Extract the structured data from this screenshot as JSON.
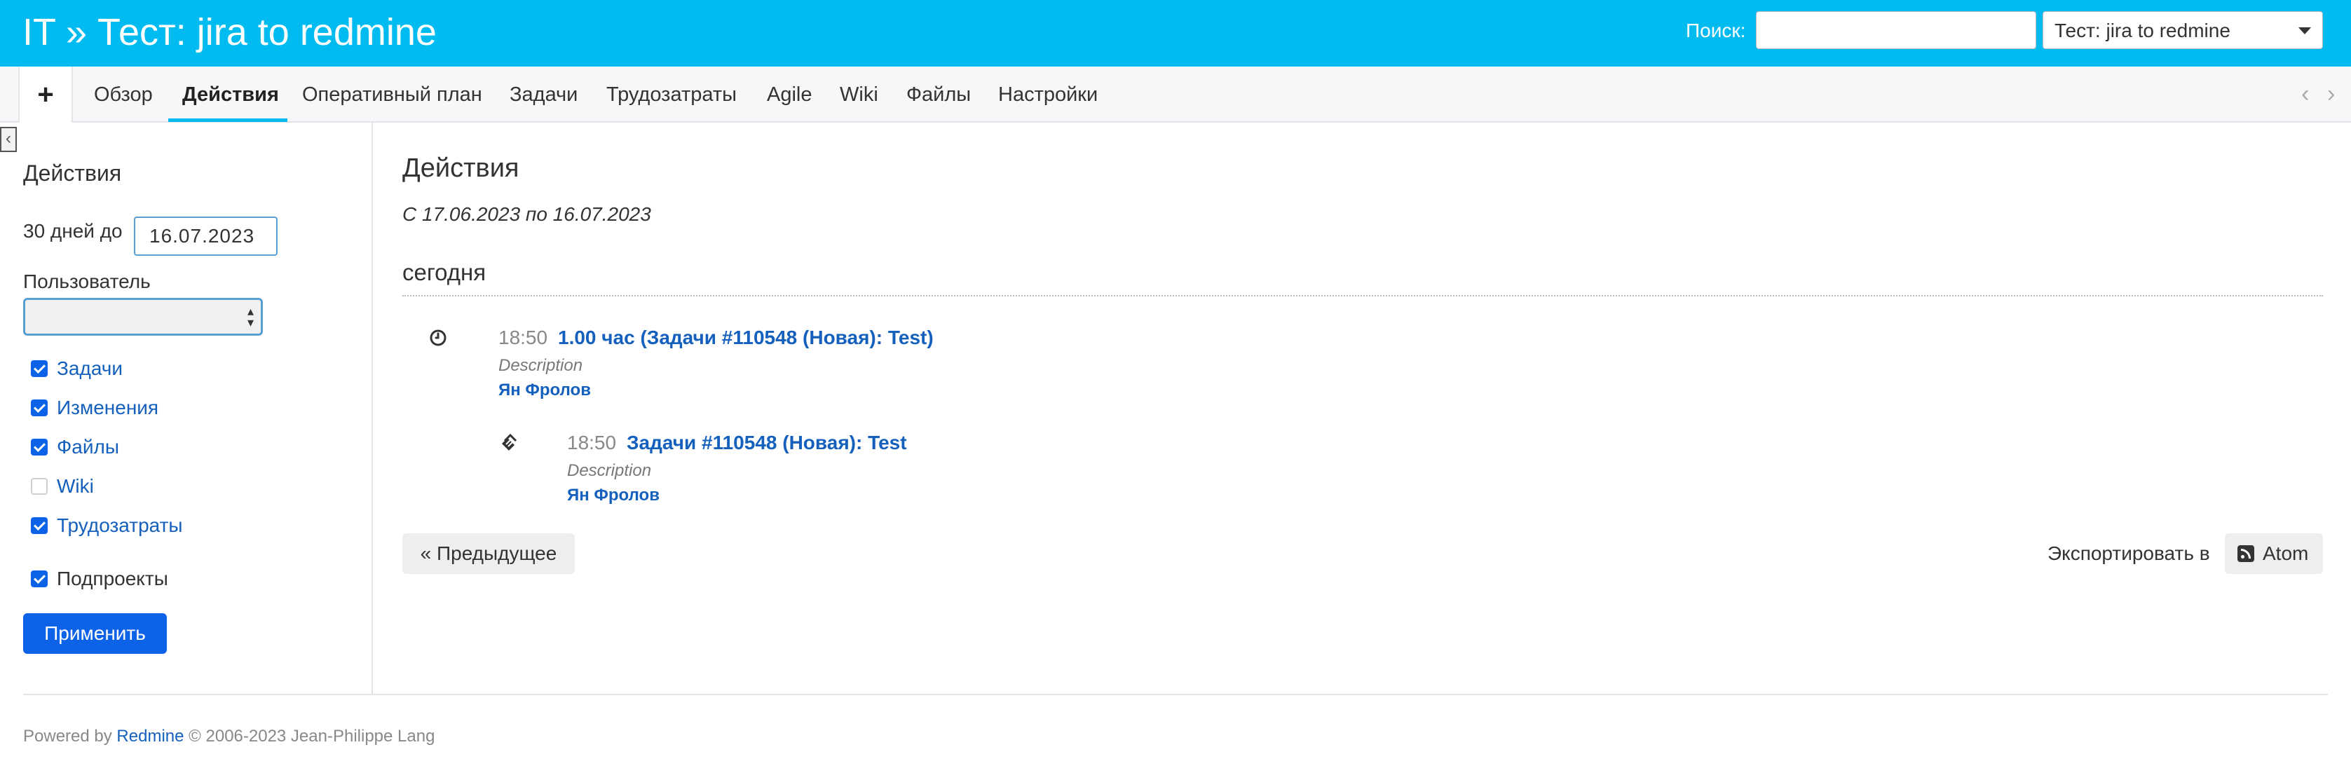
{
  "header": {
    "title": "IT » Тест: jira to redmine",
    "search_label": "Поиск:",
    "search_value": "",
    "project_select": "Тест: jira to redmine"
  },
  "menu": {
    "new_object": "+",
    "tabs": [
      {
        "label": "Обзор"
      },
      {
        "label": "Действия",
        "selected": true
      },
      {
        "label": "Оперативный план"
      },
      {
        "label": "Задачи"
      },
      {
        "label": "Трудозатраты"
      },
      {
        "label": "Agile"
      },
      {
        "label": "Wiki"
      },
      {
        "label": "Файлы"
      },
      {
        "label": "Настройки"
      }
    ],
    "scroll_left": "‹",
    "scroll_right": "›"
  },
  "sidebar": {
    "collapse": "‹",
    "title": "Действия",
    "days_label": "30 дней до",
    "date_value": "16.07.2023",
    "user_label": "Пользователь",
    "user_value": "",
    "filters": [
      {
        "label": "Задачи",
        "checked": true
      },
      {
        "label": "Изменения",
        "checked": true
      },
      {
        "label": "Файлы",
        "checked": true
      },
      {
        "label": "Wiki",
        "checked": false
      },
      {
        "label": "Трудозатраты",
        "checked": true
      }
    ],
    "subprojects_label": "Подпроекты",
    "subprojects_checked": true,
    "apply_label": "Применить"
  },
  "content": {
    "title": "Действия",
    "subtitle": "С 17.06.2023 по 16.07.2023",
    "day_title": "сегодня",
    "events": [
      {
        "icon": "clock-icon",
        "time": "18:50",
        "title": "1.00 час (Задачи #110548 (Новая): Test)",
        "description": "Description",
        "author": "Ян Фролов"
      },
      {
        "icon": "issue-note-icon",
        "time": "18:50",
        "title": "Задачи #110548 (Новая): Test",
        "description": "Description",
        "author": "Ян Фролов"
      }
    ],
    "prev_label": "« Предыдущее",
    "export_label": "Экспортировать в",
    "atom_label": "Atom"
  },
  "footer": {
    "powered_by": "Powered by",
    "redmine_link": "Redmine",
    "copyright": "© 2006-2023 Jean-Philippe Lang"
  },
  "colors": {
    "header_bg": "#00bbf0",
    "link": "#1560bd",
    "primary_button": "#0d63e8"
  }
}
